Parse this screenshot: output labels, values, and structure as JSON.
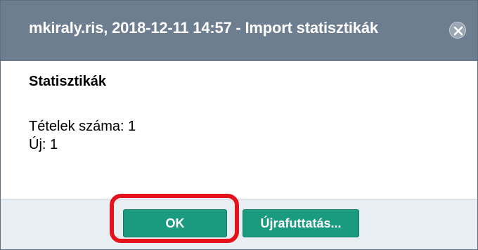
{
  "dialog": {
    "title": "mkiraly.ris, 2018-12-11 14:57 - Import statisztikák",
    "close_icon": "close-circle-x",
    "colors": {
      "titlebar": "#6d7e90",
      "button": "#1a9a7e",
      "footer": "#e9eef3",
      "highlight": "#e5141c"
    }
  },
  "content": {
    "heading": "Statisztikák",
    "stats": [
      "Tételek száma: 1",
      "Új: 1"
    ]
  },
  "footer": {
    "ok_label": "OK",
    "rerun_label": "Újrafuttatás..."
  }
}
